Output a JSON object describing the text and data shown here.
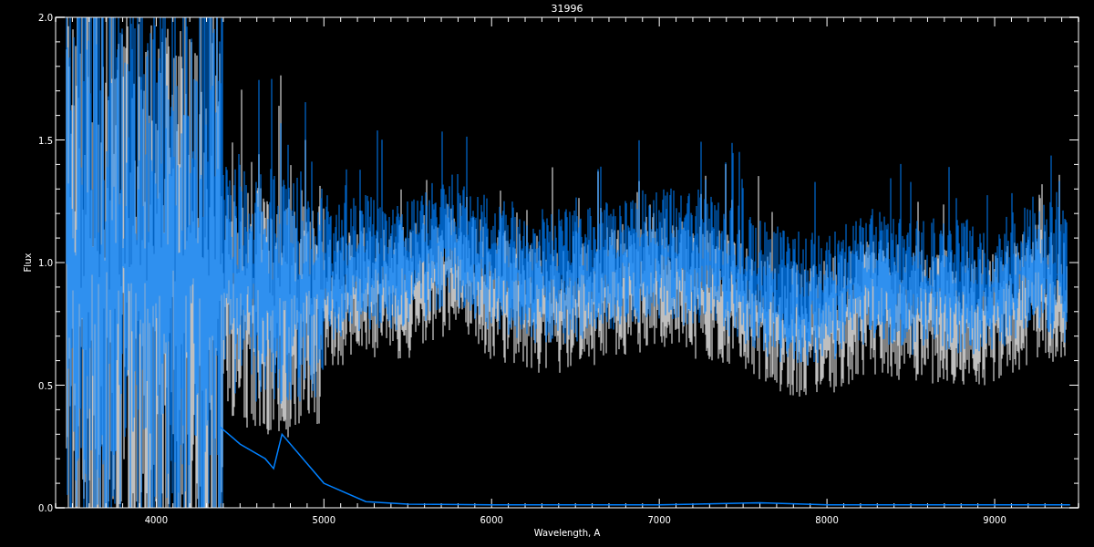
{
  "chart_data": {
    "type": "line",
    "title": "31996",
    "xlabel": "Wavelength, A",
    "ylabel": "Flux",
    "x": [
      4380,
      4500,
      4650,
      4700,
      4750,
      5000,
      5250,
      5500,
      6000,
      7000,
      7600,
      8000,
      9000,
      9450
    ],
    "series": [
      {
        "color": "#0080ff",
        "values": [
          0.33,
          0.26,
          0.2,
          0.16,
          0.3,
          0.1,
          0.025,
          0.015,
          0.012,
          0.012,
          0.02,
          0.012,
          0.012,
          0.012
        ]
      }
    ],
    "xlim": [
      3400,
      9500
    ],
    "ylim": [
      0,
      2
    ],
    "xticks": [
      4000,
      5000,
      6000,
      7000,
      8000,
      9000
    ],
    "yticks": [
      {
        "value": 0,
        "label": "0.0"
      },
      {
        "value": 0.5,
        "label": "0.5"
      },
      {
        "value": 1,
        "label": "1.0"
      },
      {
        "value": 1.5,
        "label": "1.5"
      },
      {
        "value": 2,
        "label": "2.0"
      }
    ]
  }
}
